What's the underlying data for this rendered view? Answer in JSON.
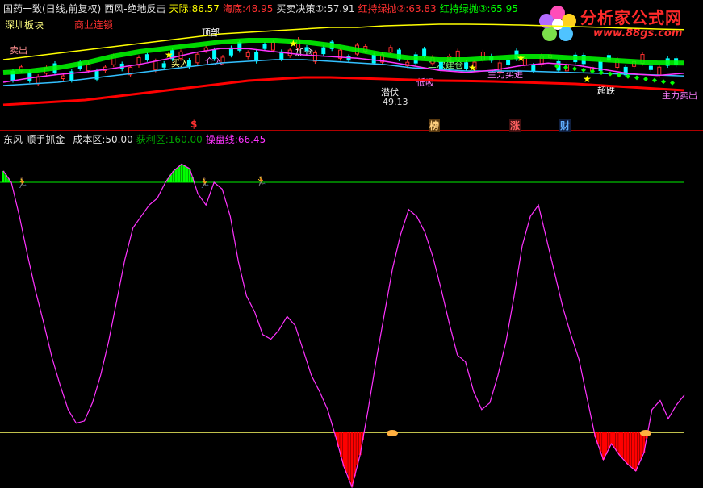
{
  "header_top": {
    "stock": "国药一致(日线,前复权)",
    "indicator": "西风-绝地反击",
    "tianji_label": "天际:",
    "tianji_value": "86.57",
    "haidi_label": "海底:",
    "haidi_value": "48.95",
    "maimai_label": "买卖决策①:",
    "maimai_value": "57.91",
    "hong2_label": "红持绿抛②:",
    "hong2_value": "63.83",
    "hong3_label": "红持绿抛③:",
    "hong3_value": "65.95"
  },
  "sector_tags": {
    "left": "深圳板块",
    "right": "商业连锁"
  },
  "header_bottom": {
    "indicator": "东风-顺手抓金",
    "cost_label": "成本区:",
    "cost_value": "50.00",
    "profit_label": "获利区:",
    "profit_value": "160.00",
    "operate_label": "操盘线:",
    "operate_value": "66.45"
  },
  "event_markers": [
    "$",
    "榜",
    "涨",
    "财"
  ],
  "price_annotations": [
    "卖出",
    "买入",
    "介入",
    "顶部",
    "加仓",
    "二次建仓",
    "低吸",
    "潜伏",
    "主力买进",
    "主力卖出",
    "超跌",
    "49.13"
  ],
  "logo": {
    "title": "分析家公式网",
    "url": "www.88gs.com"
  },
  "colors": {
    "background": "#000000",
    "upper_band": "#ffff00",
    "red_band": "#ff0000",
    "cyan_line": "#33c0ff",
    "green_band": "#00ff00",
    "magenta_line": "#ff33ff",
    "zero_line": "#00a000",
    "base_line": "#ffff66",
    "red_bars": "#ff0000",
    "green_bars": "#00ff00"
  },
  "chart_data": [
    {
      "type": "line",
      "panel": "main price panel",
      "series": [
        {
          "name": "天际",
          "color": "#ffff00",
          "values": [
            68,
            70,
            72,
            74,
            76,
            78,
            80,
            82,
            84,
            85,
            86,
            87,
            88,
            88,
            89,
            89.5,
            90,
            90,
            89.8,
            89.5,
            89,
            88.5,
            88,
            87.5,
            87,
            86.6
          ]
        },
        {
          "name": "海底",
          "color": "#ff0000",
          "values": [
            40,
            41,
            42,
            43,
            45,
            47,
            49,
            51,
            53,
            55,
            56,
            57,
            57,
            56.5,
            56,
            55.5,
            55,
            54.8,
            54.5,
            54,
            53.5,
            53,
            52,
            51,
            50,
            49
          ]
        },
        {
          "name": "买卖决策①",
          "color": "#33c0ff",
          "values": [
            52,
            53,
            54,
            56,
            58,
            60,
            62,
            64,
            66,
            67,
            68,
            68,
            67,
            66,
            65,
            63,
            62,
            61,
            61,
            61,
            60.5,
            60,
            59.5,
            59,
            58.5,
            57.9
          ]
        },
        {
          "name": "红持绿抛②",
          "color": "#00ff00",
          "values": [
            60,
            61,
            63,
            66,
            70,
            73,
            75,
            77,
            79,
            80,
            80,
            79,
            77,
            74,
            71,
            69,
            68,
            68,
            69,
            70,
            70,
            69,
            68,
            67,
            66,
            65.9
          ]
        }
      ]
    },
    {
      "type": "line",
      "panel": "oscillator panel",
      "series": [
        {
          "name": "操盘线",
          "color": "#ff33ff",
          "x": [
            0,
            1,
            2,
            3,
            4,
            5,
            6,
            7,
            8,
            9,
            10,
            11,
            12,
            13,
            14,
            15,
            16,
            17,
            18,
            19,
            20,
            21,
            22,
            23,
            24,
            25,
            26,
            27,
            28,
            29,
            30,
            31,
            32,
            33,
            34,
            35,
            36,
            37,
            38,
            39,
            40,
            41,
            42,
            43,
            44,
            45,
            46,
            47,
            48,
            49,
            50,
            51,
            52,
            53,
            54,
            55,
            56,
            57,
            58,
            59,
            60,
            61,
            62,
            63,
            64,
            65,
            66,
            67,
            68,
            69,
            70,
            71,
            72,
            73,
            74,
            75,
            76,
            77,
            78,
            79,
            80,
            81,
            82,
            83,
            84
          ],
          "values": [
            165,
            160,
            145,
            128,
            112,
            98,
            83,
            71,
            60,
            54,
            55,
            63,
            75,
            90,
            108,
            126,
            140,
            145,
            150,
            153,
            160,
            165,
            168,
            166,
            155,
            150,
            160,
            157,
            145,
            125,
            110,
            103,
            93,
            91,
            95,
            101,
            97,
            86,
            75,
            68,
            60,
            48,
            35,
            26,
            40,
            60,
            82,
            102,
            122,
            137,
            148,
            145,
            138,
            127,
            113,
            98,
            84,
            81,
            68,
            60,
            63,
            75,
            90,
            110,
            132,
            145,
            150,
            135,
            120,
            105,
            93,
            82,
            65,
            48,
            38,
            45,
            40,
            36,
            33,
            41,
            60,
            64,
            56,
            62,
            66.45
          ]
        }
      ],
      "reference_lines": {
        "成本区": 50,
        "获利区": 160
      }
    }
  ]
}
